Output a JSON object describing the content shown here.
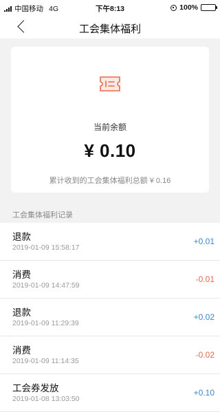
{
  "status_bar": {
    "carrier": "中国移动",
    "network": "4G",
    "time": "下午8:13",
    "battery": "100%"
  },
  "nav": {
    "title": "工会集体福利"
  },
  "balance": {
    "label": "当前余额",
    "value": "¥ 0.10",
    "total_text": "累计收到的工会集体福利总额 ¥ 0.16"
  },
  "records_section": {
    "title": "工会集体福利记录",
    "items": [
      {
        "type": "退款",
        "time": "2019-01-09 15:58:17",
        "amount": "+0.01",
        "color": "#3a86d4"
      },
      {
        "type": "消费",
        "time": "2019-01-09 14:47:59",
        "amount": "-0.01",
        "color": "#e8684a"
      },
      {
        "type": "退款",
        "time": "2019-01-09 11:29:39",
        "amount": "+0.02",
        "color": "#3a86d4"
      },
      {
        "type": "消费",
        "time": "2019-01-09 11:14:35",
        "amount": "-0.02",
        "color": "#e8684a"
      },
      {
        "type": "工会券发放",
        "time": "2019-01-08 13:03:50",
        "amount": "+0.10",
        "color": "#3a86d4"
      }
    ]
  },
  "colors": {
    "accent_red": "#e8684a",
    "accent_blue": "#3a86d4",
    "ticket_fill": "#fde9e3"
  }
}
